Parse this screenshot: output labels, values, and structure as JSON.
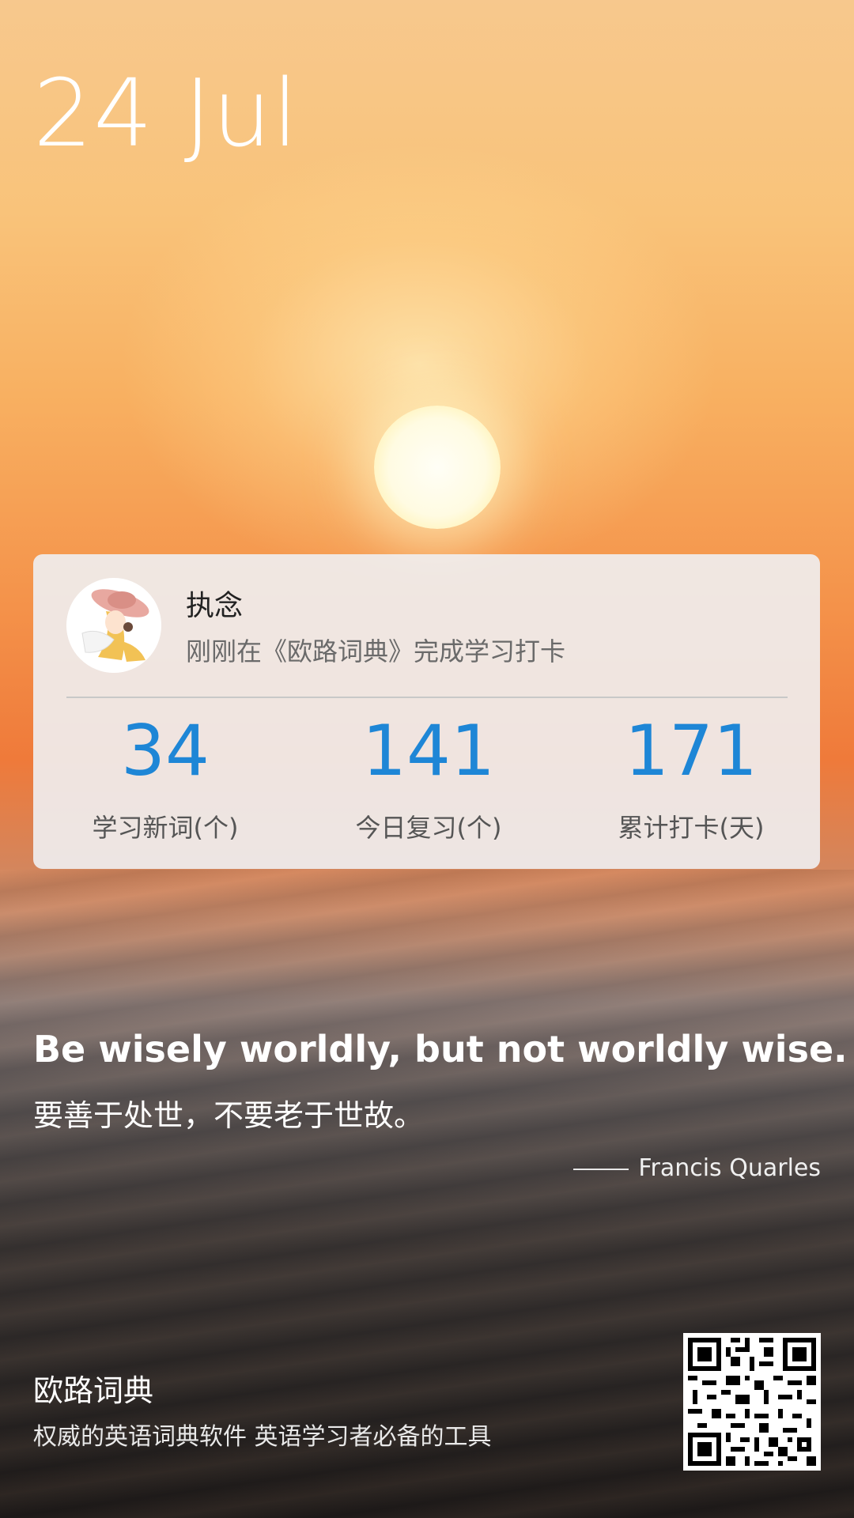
{
  "date": "24 Jul",
  "card": {
    "username": "执念",
    "subtitle": "刚刚在《欧路词典》完成学习打卡",
    "stats": [
      {
        "value": "34",
        "label": "学习新词(个)"
      },
      {
        "value": "141",
        "label": "今日复习(个)"
      },
      {
        "value": "171",
        "label": "累计打卡(天)"
      }
    ]
  },
  "quote": {
    "english": "Be wisely worldly, but not worldly wise.",
    "chinese": "要善于处世，不要老于世故。",
    "author": "Francis Quarles"
  },
  "footer": {
    "brand": "欧路词典",
    "tagline": "权威的英语词典软件 英语学习者必备的工具"
  },
  "colors": {
    "accent": "#1e86d6"
  },
  "icons": {
    "avatar": "anime-girl-avatar",
    "qr": "qr-code"
  }
}
